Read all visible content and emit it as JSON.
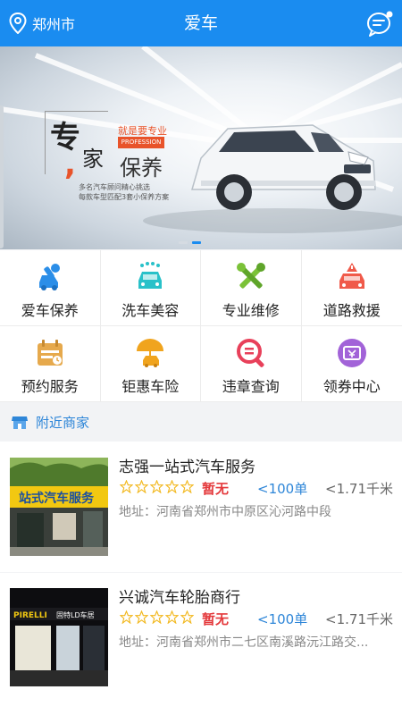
{
  "header": {
    "city": "郑州市",
    "title": "爱车",
    "location_icon": "location-pin-icon",
    "message_icon": "chat-bubble-icon",
    "color": "#1a8cf0"
  },
  "banner": {
    "big1": "专",
    "big2": "家",
    "comma": ",",
    "tag": "就是要专业",
    "prof": "PROFESSION",
    "main": "保养",
    "sub1": "多名汽车顾问精心挑选",
    "sub2": "每款车型匹配3套小保养方案",
    "slide_count": 2,
    "active_slide": 1
  },
  "services": [
    {
      "label": "爱车保养",
      "icon": "car-wrench-icon",
      "color": "#2b8ee8"
    },
    {
      "label": "洗车美容",
      "icon": "car-wash-icon",
      "color": "#29c1c9"
    },
    {
      "label": "专业维修",
      "icon": "tools-icon",
      "color": "#7bc238"
    },
    {
      "label": "道路救援",
      "icon": "rescue-car-icon",
      "color": "#f05a4a"
    },
    {
      "label": "预约服务",
      "icon": "calendar-icon",
      "color": "#e6a94c"
    },
    {
      "label": "钜惠车险",
      "icon": "insurance-umbrella-icon",
      "color": "#f0a41e"
    },
    {
      "label": "违章查询",
      "icon": "violation-search-icon",
      "color": "#e8405a"
    },
    {
      "label": "领券中心",
      "icon": "coupon-icon",
      "color": "#a263d8"
    }
  ],
  "nearby": {
    "title": "附近商家",
    "icon": "shop-icon"
  },
  "merchants": [
    {
      "name": "志强一站式汽车服务",
      "rating": "暂无",
      "stars": 0,
      "orders": "<100单",
      "distance": "<1.71千米",
      "address": "地址：河南省郑州市中原区沁河路中段"
    },
    {
      "name": "兴诚汽车轮胎商行",
      "rating": "暂无",
      "stars": 0,
      "orders": "<100单",
      "distance": "<1.71千米",
      "address": "地址：河南省郑州市二七区南溪路沅江路交..."
    }
  ],
  "thumb_signs": {
    "m1": "站式汽车服务",
    "m2_left": "PIRELLI",
    "m2_right": "固特LD车居"
  }
}
